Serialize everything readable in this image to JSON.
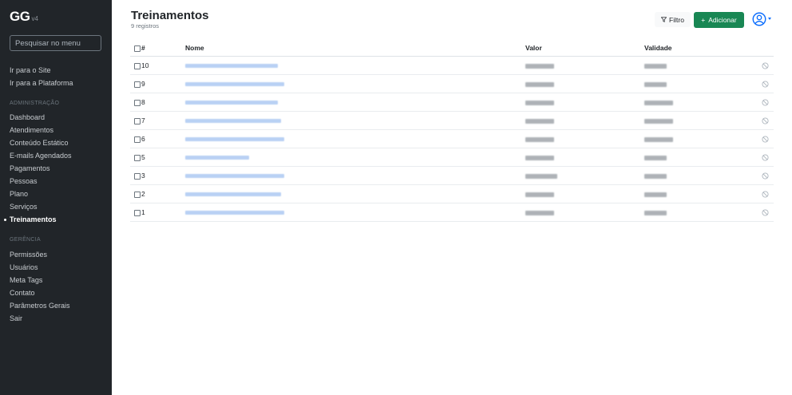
{
  "app": {
    "logo": "GG",
    "version": "v4"
  },
  "sidebar": {
    "search_placeholder": "Pesquisar no menu",
    "top_links": [
      "Ir para o Site",
      "Ir para a Plataforma"
    ],
    "section_admin": "ADMINISTRAÇÃO",
    "admin_items": [
      "Dashboard",
      "Atendimentos",
      "Conteúdo Estático",
      "E-mails Agendados",
      "Pagamentos",
      "Pessoas",
      "Plano",
      "Serviços",
      "Treinamentos"
    ],
    "active_item": "Treinamentos",
    "section_management": "GERÊNCIA",
    "management_items": [
      "Permissões",
      "Usuários",
      "Meta Tags",
      "Contato",
      "Parâmetros Gerais",
      "Sair"
    ]
  },
  "header": {
    "title": "Treinamentos",
    "subtitle": "9 registros",
    "filter_label": "Filtro",
    "add_label": "Adicionar"
  },
  "table": {
    "columns": [
      "#",
      "Nome",
      "Valor",
      "Validade"
    ],
    "rows": [
      {
        "id": "10"
      },
      {
        "id": "9"
      },
      {
        "id": "8"
      },
      {
        "id": "7"
      },
      {
        "id": "6"
      },
      {
        "id": "5"
      },
      {
        "id": "3"
      },
      {
        "id": "2"
      },
      {
        "id": "1"
      }
    ]
  },
  "colors": {
    "sidebar_bg": "#212529",
    "primary": "#0d6efd",
    "success": "#198754",
    "link_blur": "#b9d1f4"
  },
  "icons": {
    "filter": "filter-icon",
    "add": "plus-icon",
    "user": "user-circle-icon",
    "row_action": "disabled-icon"
  }
}
